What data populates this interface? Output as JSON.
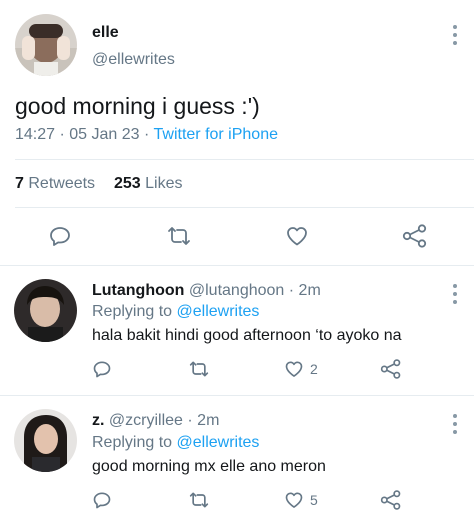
{
  "tweet": {
    "name": "elle",
    "handle": "@ellewrites",
    "text": "good morning i guess :')",
    "time": "14:27",
    "sep1": "·",
    "date": "05 Jan 23",
    "sep2": "·",
    "source": "Twitter for iPhone",
    "retweets_count": "7",
    "retweets_label": "Retweets",
    "likes_count": "253",
    "likes_label": "Likes"
  },
  "replies": [
    {
      "name": "Lutanghoon",
      "handle": "@lutanghoon",
      "time": "· 2m",
      "replying_label": "Replying to",
      "replying_to": "@ellewrites",
      "text": "hala bakit hindi good afternoon ‘to ayoko na",
      "likes": "2"
    },
    {
      "name": "z.",
      "handle": "@zcryillee",
      "time": "· 2m",
      "replying_label": "Replying to",
      "replying_to": "@ellewrites",
      "text": "good morning mx elle ano meron",
      "likes": "5"
    }
  ],
  "icons": {
    "reply": "reply-icon",
    "retweet": "retweet-icon",
    "like": "heart-icon",
    "share": "share-icon",
    "more": "more-icon"
  },
  "colors": {
    "link": "#1da1f2",
    "muted": "#657786",
    "divider": "#e6ecf0"
  }
}
